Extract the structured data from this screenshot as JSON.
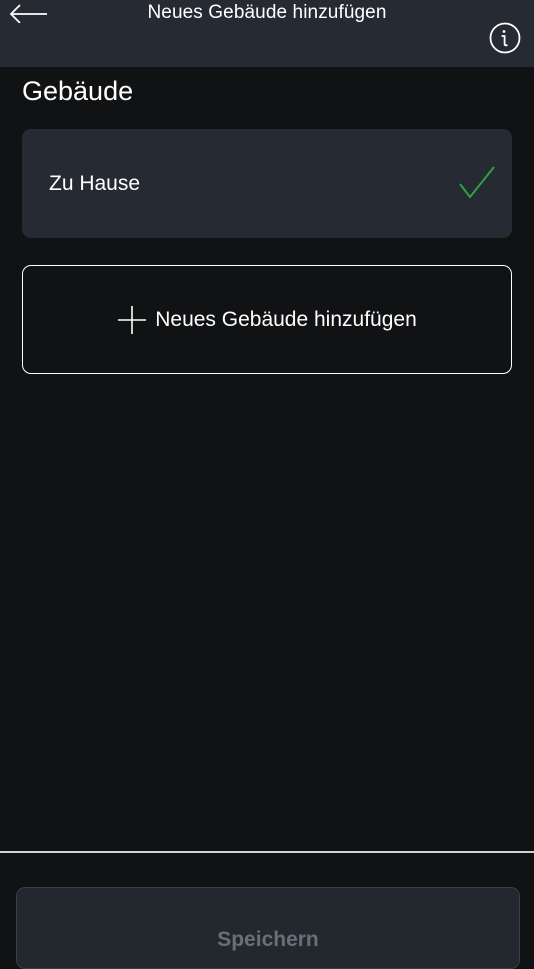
{
  "header": {
    "title": "Neues Gebäude hinzufügen",
    "back_icon": "arrow-left-icon",
    "info_icon": "info-icon"
  },
  "section": {
    "title": "Gebäude"
  },
  "buildings": [
    {
      "name": "Zu Hause",
      "selected": true,
      "check_color": "#2ea043"
    }
  ],
  "add_building": {
    "icon": "plus-icon",
    "label": "Neues Gebäude hinzufügen"
  },
  "footer": {
    "save_label": "Speichern",
    "save_enabled": false
  },
  "colors": {
    "background": "#111214",
    "header": "#262a33",
    "card": "#262a33",
    "accent_check": "#2ea043",
    "disabled_text": "#6a6f77"
  }
}
